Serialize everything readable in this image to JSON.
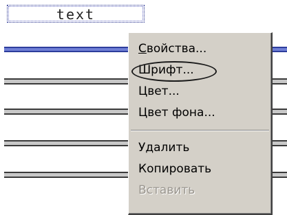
{
  "canvas": {
    "text_object_label": "text"
  },
  "context_menu": {
    "items": [
      {
        "label": "Свойства...",
        "enabled": true
      },
      {
        "label": "Шрифт...",
        "enabled": true,
        "highlighted": true
      },
      {
        "label": "Цвет...",
        "enabled": true
      },
      {
        "label": "Цвет фона...",
        "enabled": true
      }
    ],
    "items2": [
      {
        "label": "Удалить",
        "enabled": true
      },
      {
        "label": "Копировать",
        "enabled": true
      },
      {
        "label": "Вставить",
        "enabled": false
      }
    ]
  },
  "colors": {
    "menu_background": "#d4d0c8",
    "selected_line": "#6f7fd6",
    "line": "#c8c8c8",
    "disabled_text": "#9a968f"
  }
}
